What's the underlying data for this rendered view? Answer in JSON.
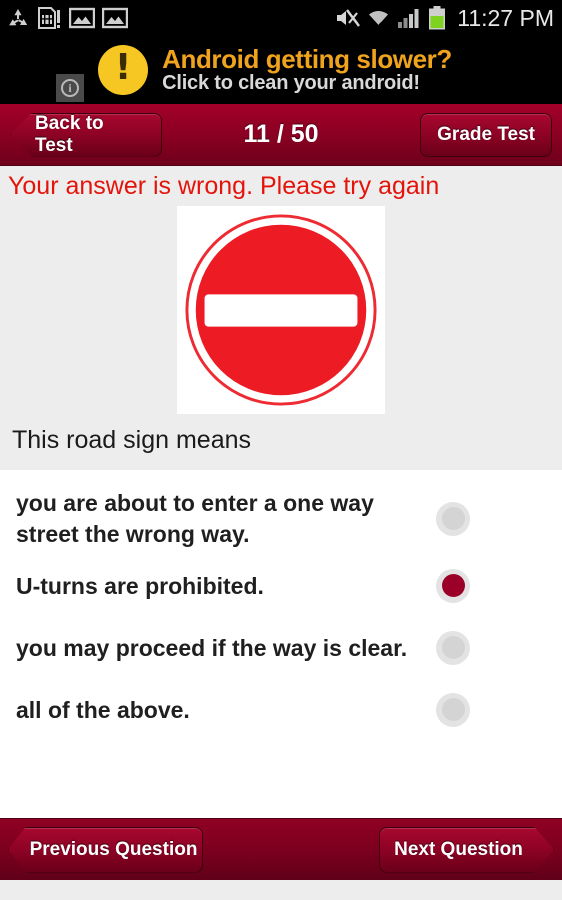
{
  "statusbar": {
    "icons_left": [
      "recycle-icon",
      "sim-card-alert-icon",
      "image-icon",
      "image-icon"
    ],
    "icons_right": [
      "mute-icon",
      "wifi-transfer-icon",
      "signal-bars-icon",
      "battery-icon"
    ],
    "clock": "11:27 PM",
    "background": "#000000",
    "text_color": "#e8e8e8"
  },
  "ad": {
    "info_glyph": "i",
    "alert_glyph": "!",
    "line1": "Android getting slower?",
    "line2": "Click to clean your android!",
    "line1_color": "#f0a31c",
    "line2_color": "#d9d9d9",
    "badge_color": "#f6c723"
  },
  "header": {
    "back_label": "Back to Test",
    "counter": "11 / 50",
    "grade_label": "Grade Test",
    "background": "#8a0022"
  },
  "feedback": {
    "message": "Your answer is wrong. Please try again",
    "color": "#e4140b"
  },
  "question": {
    "sign": "no-entry-sign",
    "sign_colors": {
      "ring": "#e8202a",
      "body": "#ed1c24",
      "bar": "#ffffff"
    },
    "text": "This road sign means"
  },
  "options": {
    "items": [
      {
        "label": "you are about to enter a one way street the wrong way.",
        "selected": false
      },
      {
        "label": "U-turns are prohibited.",
        "selected": true
      },
      {
        "label": "you may proceed if the way is clear.",
        "selected": false
      },
      {
        "label": "all of the above.",
        "selected": false
      }
    ],
    "selected_color": "#9b0028",
    "unselected_color": "#d4d4d4"
  },
  "bottomnav": {
    "prev_label": "Previous Question",
    "next_label": "Next Question",
    "background": "#7d001f"
  }
}
